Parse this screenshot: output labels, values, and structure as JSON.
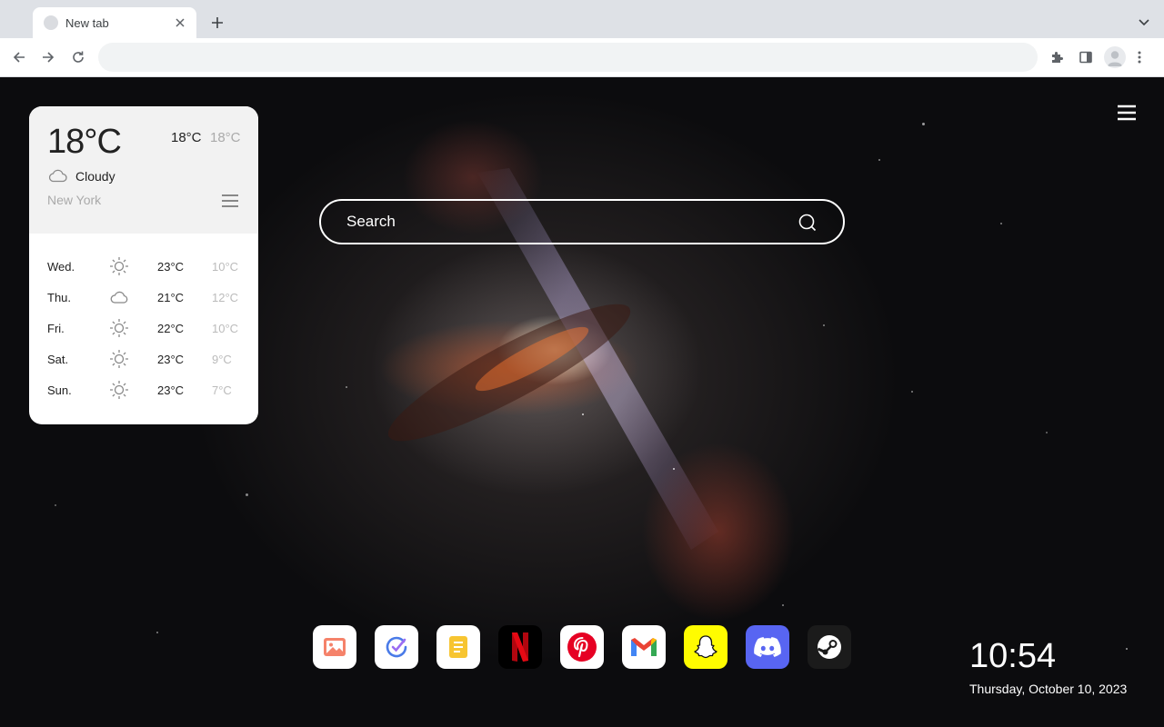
{
  "browser": {
    "tab_title": "New tab",
    "address_value": "",
    "colors": {
      "tabstrip": "#dee1e6",
      "toolbar": "#ffffff",
      "omnibox": "#f1f3f4"
    },
    "icons": [
      "favicon-icon",
      "close-icon",
      "plus-icon",
      "chevron-down-icon",
      "back-icon",
      "forward-icon",
      "reload-icon",
      "extensions-icon",
      "side-panel-icon",
      "profile-icon",
      "more-vert-icon"
    ]
  },
  "weather": {
    "current_temp": "18°C",
    "high": "18°C",
    "low": "18°C",
    "condition": "Cloudy",
    "condition_icon": "cloud-icon",
    "city": "New York",
    "forecast": [
      {
        "day": "Wed.",
        "icon": "sun-icon",
        "high": "23°C",
        "low": "10°C"
      },
      {
        "day": "Thu.",
        "icon": "cloud-icon",
        "high": "21°C",
        "low": "12°C"
      },
      {
        "day": "Fri.",
        "icon": "sun-icon",
        "high": "22°C",
        "low": "10°C"
      },
      {
        "day": "Sat.",
        "icon": "sun-icon",
        "high": "23°C",
        "low": "9°C"
      },
      {
        "day": "Sun.",
        "icon": "sun-icon",
        "high": "23°C",
        "low": "7°C"
      }
    ]
  },
  "search": {
    "placeholder": "Search"
  },
  "dock": [
    {
      "name": "photos-app",
      "icon": "photos-icon",
      "bg": "#ffffff"
    },
    {
      "name": "tasks-app",
      "icon": "check-circle-icon",
      "bg": "#ffffff"
    },
    {
      "name": "notes-app",
      "icon": "notes-icon",
      "bg": "#ffffff"
    },
    {
      "name": "netflix-app",
      "icon": "netflix-icon",
      "bg": "#000000"
    },
    {
      "name": "pinterest-app",
      "icon": "pinterest-icon",
      "bg": "#ffffff"
    },
    {
      "name": "gmail-app",
      "icon": "gmail-icon",
      "bg": "#ffffff"
    },
    {
      "name": "snapchat-app",
      "icon": "snapchat-icon",
      "bg": "#fffc00"
    },
    {
      "name": "discord-app",
      "icon": "discord-icon",
      "bg": "#5865f2"
    },
    {
      "name": "steam-app",
      "icon": "steam-icon",
      "bg": "#1b1b1b"
    }
  ],
  "clock": {
    "time": "10:54",
    "date": "Thursday, October 10, 2023"
  }
}
